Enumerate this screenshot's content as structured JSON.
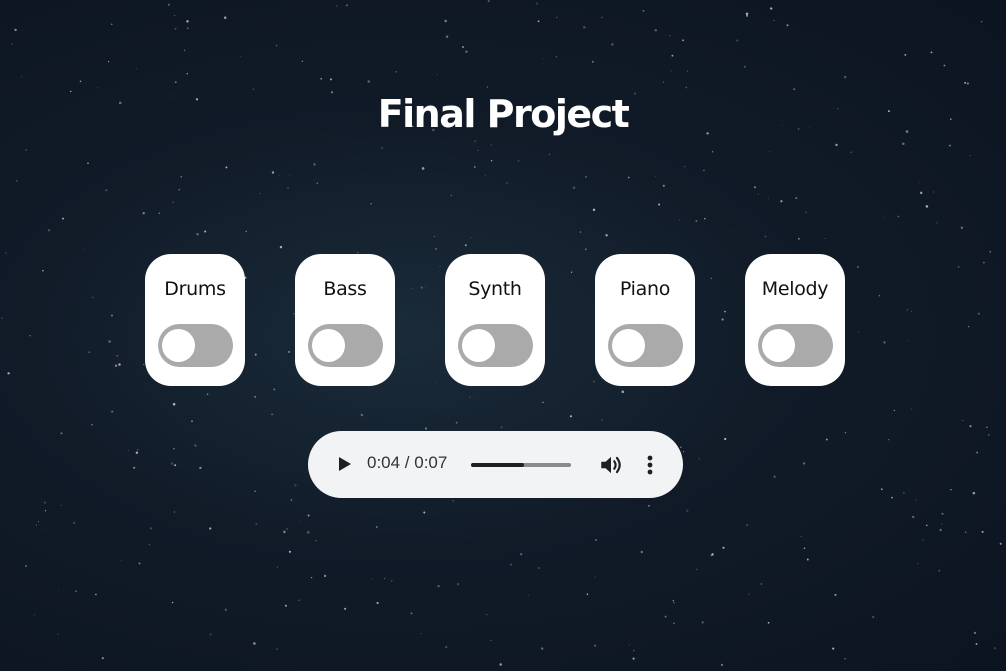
{
  "page": {
    "title": "Final Project"
  },
  "tracks": [
    {
      "label": "Drums",
      "enabled": false
    },
    {
      "label": "Bass",
      "enabled": false
    },
    {
      "label": "Synth",
      "enabled": false
    },
    {
      "label": "Piano",
      "enabled": false
    },
    {
      "label": "Melody",
      "enabled": false
    }
  ],
  "player": {
    "current_time": "0:04",
    "duration": "0:07",
    "time_display": "0:04 / 0:07",
    "progress": 0.53
  },
  "icons": {
    "play": "play-icon",
    "volume": "volume-icon",
    "more": "more-vert-icon"
  },
  "colors": {
    "background": "#111b28",
    "card": "#ffffff",
    "toggle_off": "#aaaaaa",
    "player_bg": "#f1f3f4",
    "progress_fill": "#1f1f1f"
  }
}
